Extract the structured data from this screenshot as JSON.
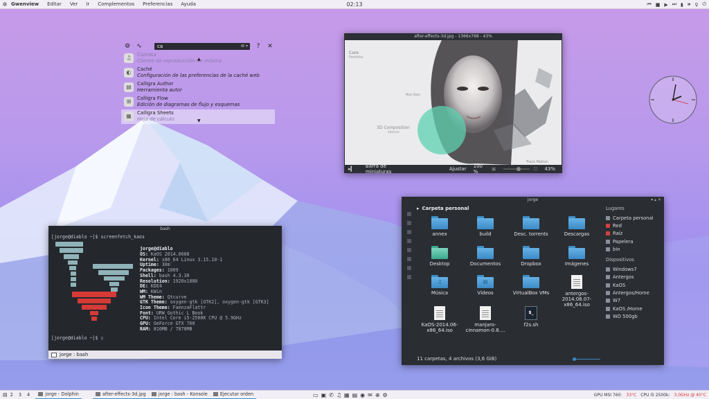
{
  "top_panel": {
    "app_name": "Gwenview",
    "menu": [
      "Editar",
      "Ver",
      "Ir",
      "Complementos",
      "Preferencias",
      "Ayuda"
    ],
    "clock": "02:13"
  },
  "krunner": {
    "query": "ca",
    "items": [
      {
        "title": "Cantata",
        "subtitle": "Cliente de reproducción de música",
        "icon": "music-icon"
      },
      {
        "title": "Caché",
        "subtitle": "Configuración de las preferencias de la caché web",
        "icon": "cache-icon"
      },
      {
        "title": "Calligra Author",
        "subtitle": "Herramienta autor",
        "icon": "author-icon"
      },
      {
        "title": "Calligra Flow",
        "subtitle": "Edición de diagramas de flujo y esquemas",
        "icon": "flow-icon"
      },
      {
        "title": "Calligra Sheets",
        "subtitle": "Hoja de cálculo",
        "icon": "sheets-icon"
      }
    ]
  },
  "gwenview": {
    "title": "after-effects-3d.jpg - 1366x768 - 43%",
    "image_texts": {
      "top_left_1": "Core",
      "top_left_2": "Portfolio",
      "center_label": "Main Style",
      "composition": "3D Composition",
      "composition_sub": "Abstract",
      "bottom_right": "Track Motion"
    },
    "thumbnail_bar": "Barra de miniaturas",
    "fit": "Ajustar",
    "zoom_100": "100 %",
    "zoom_pct": "43%",
    "zoom_level": 0.43
  },
  "konsole": {
    "title": "bash",
    "prompt_cmd": "[jorge@diablo ~]$ screenfetch_kaos",
    "prompt_end": "[jorge@diablo ~]$ ▯",
    "user": "jorge@diablo",
    "info": [
      {
        "k": "OS:",
        "v": "KaOS 2014.0608"
      },
      {
        "k": "Kernel:",
        "v": "x86_64 Linux 3.15.10-1"
      },
      {
        "k": "Uptime:",
        "v": "30m"
      },
      {
        "k": "Packages:",
        "v": "1009"
      },
      {
        "k": "Shell:",
        "v": "bash 4.3.30"
      },
      {
        "k": "Resolution:",
        "v": "1920x1080"
      },
      {
        "k": "DE:",
        "v": "KDE4"
      },
      {
        "k": "WM:",
        "v": "KWin"
      },
      {
        "k": "WM Theme:",
        "v": "Qtcurve"
      },
      {
        "k": "GTK Theme:",
        "v": "oxygen-gtk [GTK2], oxygen-gtk [GTK3]"
      },
      {
        "k": "Icon Theme:",
        "v": "FaenzaFlattr"
      },
      {
        "k": "Font:",
        "v": "URW Gothic L Book"
      },
      {
        "k": "CPU:",
        "v": "Intel Core i5-2500K CPU @ 5.9GHz"
      },
      {
        "k": "GPU:",
        "v": "GeForce GTX 760"
      },
      {
        "k": "RAM:",
        "v": "810MB / 7870MB"
      }
    ],
    "tab_label": "jorge : bash"
  },
  "dolphin": {
    "title": "jorge",
    "location": "Carpeta personal",
    "items": [
      {
        "name": "annex",
        "kind": "folder",
        "sym": ""
      },
      {
        "name": "build",
        "kind": "folder",
        "sym": ""
      },
      {
        "name": "Desc. torrents",
        "kind": "folder",
        "sym": ""
      },
      {
        "name": "Descargas",
        "kind": "folder",
        "sym": ""
      },
      {
        "name": "Desktop",
        "kind": "desktop",
        "sym": ""
      },
      {
        "name": "Documentos",
        "kind": "folder",
        "sym": ""
      },
      {
        "name": "Dropbox",
        "kind": "folder",
        "sym": ""
      },
      {
        "name": "Imágenes",
        "kind": "folder",
        "sym": ""
      },
      {
        "name": "Música",
        "kind": "folder",
        "sym": "♫"
      },
      {
        "name": "Vídeos",
        "kind": "folder",
        "sym": "▤"
      },
      {
        "name": "VirtualBox VMs",
        "kind": "folder",
        "sym": ""
      },
      {
        "name": "antergos-2014.08.07-x86_64.iso",
        "kind": "file",
        "sym": ""
      },
      {
        "name": "KaOS-2014.06-x86_64.iso",
        "kind": "file",
        "sym": ""
      },
      {
        "name": "manjaro-cinnamon-0.8....",
        "kind": "file",
        "sym": ""
      },
      {
        "name": "f2s.sh",
        "kind": "script",
        "sym": "$_"
      }
    ],
    "status": "11 carpetas, 4 archivos (3,6 GiB)",
    "places_header": "Lugares",
    "places": [
      "Carpeta personal",
      "Red",
      "Raíz",
      "Papelera",
      "bin"
    ],
    "devices_header": "Dispositivos",
    "devices": [
      "Windows7",
      "Antergos",
      "KaOS",
      "Antergos/Home",
      "W7",
      "KaOS /Home",
      "WD 500gb"
    ]
  },
  "bottom_panel": {
    "pager": [
      "2",
      "3",
      "4"
    ],
    "tasks": [
      "jorge - Dolphin",
      "after-effects-3d.jpg",
      "jorge : bash - Konsole",
      "Ejecutar orden"
    ],
    "sysinfo": [
      {
        "label": "GPU MSI 760:",
        "value": "33°C"
      },
      {
        "label": "CPU i5 2500k:",
        "value": "3.0GHz @ 40°C"
      }
    ]
  },
  "colors": {
    "accent": "#3c8ac6",
    "window_bg": "#2c2f35",
    "panel_bg": "#f1eff5",
    "logo_red": "#d63a36",
    "logo_teal": "#8fb3b8"
  }
}
